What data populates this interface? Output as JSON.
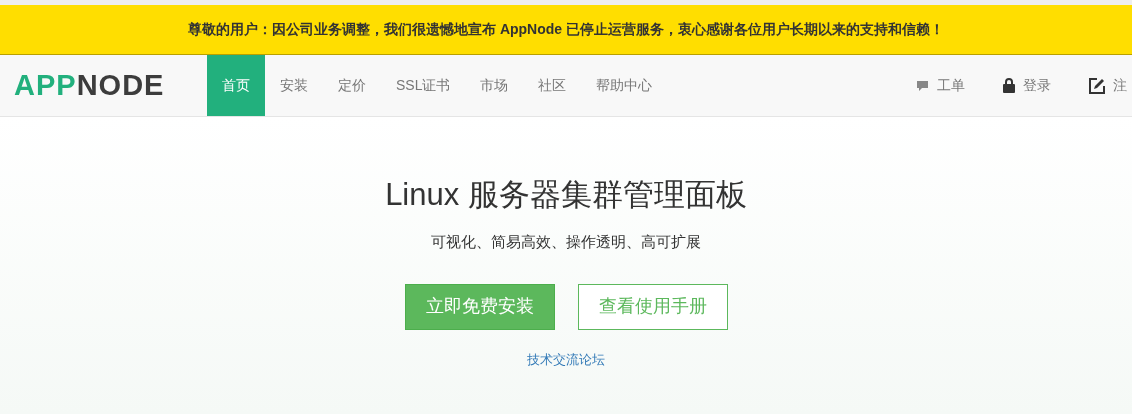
{
  "banner": {
    "text": "尊敬的用户：因公司业务调整，我们很遗憾地宣布 AppNode 已停止运营服务，衷心感谢各位用户长期以来的支持和信赖！"
  },
  "logo": {
    "parts": [
      {
        "text": "APP",
        "color": "#22b07d"
      },
      {
        "text": "NODE",
        "color": "#3c3c3c"
      }
    ]
  },
  "nav": {
    "items": [
      {
        "label": "首页",
        "selected": true
      },
      {
        "label": "安装",
        "selected": false
      },
      {
        "label": "定价",
        "selected": false
      },
      {
        "label": "SSL证书",
        "selected": false
      },
      {
        "label": "市场",
        "selected": false
      },
      {
        "label": "社区",
        "selected": false
      },
      {
        "label": "帮助中心",
        "selected": false
      }
    ],
    "right_items": [
      {
        "kind": "ticket",
        "label": "工单"
      },
      {
        "kind": "login",
        "label": "登录"
      },
      {
        "kind": "register",
        "label": "注"
      }
    ]
  },
  "hero": {
    "title": "Linux 服务器集群管理面板",
    "subtitle": "可视化、简易高效、操作透明、高可扩展",
    "primary_button": "立即免费安装",
    "secondary_button": "查看使用手册",
    "link": "技术交流论坛"
  }
}
